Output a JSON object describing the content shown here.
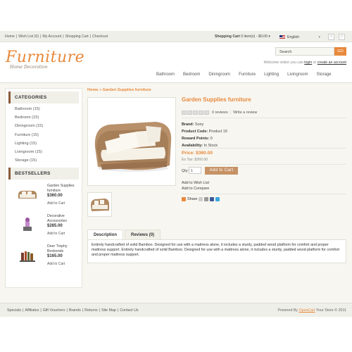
{
  "top_links": [
    "Home",
    "Wish List (0)",
    "My Account",
    "Shopping Cart",
    "Checkout"
  ],
  "cart_top": {
    "label": "Shopping Cart",
    "summary": "0 item(s) - $0.00",
    "dropdown": "▾"
  },
  "language": "English",
  "logo": {
    "title": "Furniture",
    "subtitle": "Home Decoration"
  },
  "search": {
    "placeholder": "Search",
    "button": "GO"
  },
  "welcome": {
    "text": "Welcome visitor you can",
    "login": "login",
    "or": "or",
    "create": "create an account"
  },
  "nav": [
    "Bathroom",
    "Bedroom",
    "Diningroom",
    "Furniture",
    "Lighting",
    "Livingroom",
    "Storage"
  ],
  "categories": {
    "title": "CATEGORIES",
    "items": [
      "Bathroom (15)",
      "Bedroom (15)",
      "Diningroom (15)",
      "Furniture (15)",
      "Lighting (15)",
      "Livingroom (15)",
      "Storage (15)"
    ]
  },
  "bestsellers": {
    "title": "BESTSELLERS",
    "items": [
      {
        "name": "Garden Supplies furniture",
        "price": "$360.00",
        "cart": "Add to Cart"
      },
      {
        "name": "Decorative Accessories",
        "price": "$285.00",
        "cart": "Add to Cart"
      },
      {
        "name": "Deer Trophy Bookends",
        "price": "$165.00",
        "cart": "Add to Cart"
      }
    ]
  },
  "breadcrumb": {
    "home": "Home",
    "sep": "»",
    "current": "Garden Supplies furniture"
  },
  "product": {
    "title": "Garden Supplies furniture",
    "reviews": "0 reviews",
    "write_review": "Write a review",
    "brand_label": "Brand:",
    "brand": "Sony",
    "code_label": "Product Code:",
    "code": "Product 19",
    "points_label": "Reward Points:",
    "points": "0",
    "avail_label": "Availability:",
    "avail": "In Stock",
    "price": "Price: $360.00",
    "extax": "Ex Tax: $360.00",
    "qty_label": "Qty:",
    "qty": "1",
    "add_to_cart": "Add to Cart",
    "wishlist": "Add to Wish List",
    "compare": "Add to Compare",
    "share": "Share"
  },
  "tabs": [
    "Description",
    "Reviews (0)"
  ],
  "description": "Entirely handcrafted of solid Bamboo. Designed for use with a mattress alone, it includes a sturdy, padded wood platform for comfort and proper mattress support. Entirely handcrafted of solid Bamboo. Designed for use with a mattress alone, it includes a sturdy, padded wood platform for comfort and proper mattress support.",
  "footer": {
    "links": [
      "Specials",
      "Affiliates",
      "Gift Vouchers",
      "Brands",
      "Returns",
      "Site Map",
      "Contact Us"
    ],
    "powered_prefix": "Powered By",
    "powered_link": "OpenCart",
    "powered_suffix": "Your Store © 2011"
  },
  "colors": {
    "accent": "#e8893c",
    "button": "#c69265",
    "bar": "#efefe9"
  }
}
